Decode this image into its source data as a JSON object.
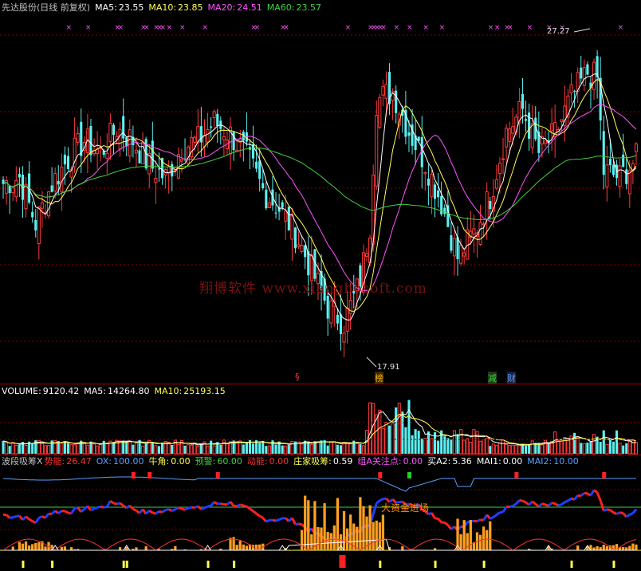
{
  "colors": {
    "up": "#ff3a3a",
    "down": "#5cf0f0",
    "ma5": "#ffffff",
    "ma10": "#ffff54",
    "ma20": "#ff54ff",
    "ma60": "#40d040",
    "grid": "#8a0000",
    "label": "#c0c0c0",
    "value": "#ffffff"
  },
  "price_panel": {
    "title": "先达股份(日线 前复权)",
    "indicators": [
      {
        "label": "MA5:",
        "value": "23.55",
        "color": "#ffffff"
      },
      {
        "label": "MA10:",
        "value": "23.85",
        "color": "#ffff54"
      },
      {
        "label": "MA20:",
        "value": "24.51",
        "color": "#ff54ff"
      },
      {
        "label": "MA60:",
        "value": "23.57",
        "color": "#40d040"
      }
    ],
    "high_label": "27.27",
    "low_label": "17.91",
    "markers": [
      {
        "text": "§",
        "color": "#ff3030"
      },
      {
        "text": "榜",
        "color": "#ffb000"
      },
      {
        "text": "减",
        "color": "#40d040"
      },
      {
        "text": "财",
        "color": "#5ca0ff"
      }
    ],
    "star_mark": "×"
  },
  "volume_panel": {
    "indicators": [
      {
        "label": "VOLUME:",
        "value": "9120.42",
        "color": "#ffffff"
      },
      {
        "label": "MA5:",
        "value": "14264.80",
        "color": "#ffffff"
      },
      {
        "label": "MA10:",
        "value": "25193.15",
        "color": "#ffff54"
      }
    ]
  },
  "indicator_panel": {
    "name": "波段吸筹X",
    "indicators": [
      {
        "label": "势能:",
        "value": "26.47",
        "lcolor": "#ff3030",
        "vcolor": "#ff3030"
      },
      {
        "label": "OX:",
        "value": "100.00",
        "lcolor": "#5ca0ff",
        "vcolor": "#5ca0ff"
      },
      {
        "label": "牛角:",
        "value": "0.00",
        "lcolor": "#ffff54",
        "vcolor": "#ffff54"
      },
      {
        "label": "预警:",
        "value": "60.00",
        "lcolor": "#40d040",
        "vcolor": "#40d040"
      },
      {
        "label": "动能:",
        "value": "0.00",
        "lcolor": "#ff3030",
        "vcolor": "#ff3030"
      },
      {
        "label": "庄家吸筹:",
        "value": "0.59",
        "lcolor": "#ffff54",
        "vcolor": "#ffffff"
      },
      {
        "label": "组A关注点:",
        "value": "0.00",
        "lcolor": "#ff54ff",
        "vcolor": "#ff54ff"
      },
      {
        "label": "买A2:",
        "value": "5.36",
        "lcolor": "#ffffff",
        "vcolor": "#ffffff"
      },
      {
        "label": "MAI1:",
        "value": "0.00",
        "lcolor": "#ffffff",
        "vcolor": "#ffffff"
      },
      {
        "label": "MAI2:",
        "value": "10.00",
        "lcolor": "#5ca0ff",
        "vcolor": "#5ca0ff"
      }
    ],
    "annotation": "大资金进场"
  },
  "watermark": "翔博软件 www.xiangbosoft.com",
  "chart_data": {
    "type": "candlestick",
    "anchor_points": [
      [
        0,
        22.8
      ],
      [
        5,
        23.0
      ],
      [
        10,
        21.5
      ],
      [
        15,
        22.8
      ],
      [
        20,
        23.6
      ],
      [
        25,
        24.2
      ],
      [
        30,
        23.8
      ],
      [
        35,
        24.6
      ],
      [
        40,
        24.2
      ],
      [
        45,
        23.4
      ],
      [
        50,
        23.0
      ],
      [
        55,
        24.0
      ],
      [
        60,
        24.2
      ],
      [
        65,
        24.8
      ],
      [
        70,
        24.4
      ],
      [
        75,
        23.7
      ],
      [
        80,
        22.6
      ],
      [
        85,
        22.0
      ],
      [
        90,
        21.2
      ],
      [
        95,
        20.0
      ],
      [
        100,
        18.8
      ],
      [
        105,
        18.3
      ],
      [
        110,
        19.6
      ],
      [
        113,
        21.5
      ],
      [
        115,
        25.5
      ],
      [
        120,
        25.8
      ],
      [
        125,
        24.5
      ],
      [
        130,
        23.5
      ],
      [
        135,
        22.2
      ],
      [
        140,
        20.4
      ],
      [
        145,
        21.2
      ],
      [
        150,
        22.4
      ],
      [
        155,
        24.5
      ],
      [
        160,
        25.2
      ],
      [
        165,
        23.8
      ],
      [
        170,
        24.4
      ],
      [
        175,
        25.6
      ],
      [
        180,
        26.4
      ],
      [
        183,
        26.2
      ],
      [
        185,
        23.2
      ],
      [
        190,
        23.0
      ],
      [
        195,
        23.6
      ]
    ],
    "price_high": 27.27,
    "price_low": 17.91,
    "n_bars": 196,
    "indicator_lines": {
      "ma5": "white",
      "ma10": "yellow",
      "ma20": "magenta",
      "ma60": "green"
    }
  }
}
